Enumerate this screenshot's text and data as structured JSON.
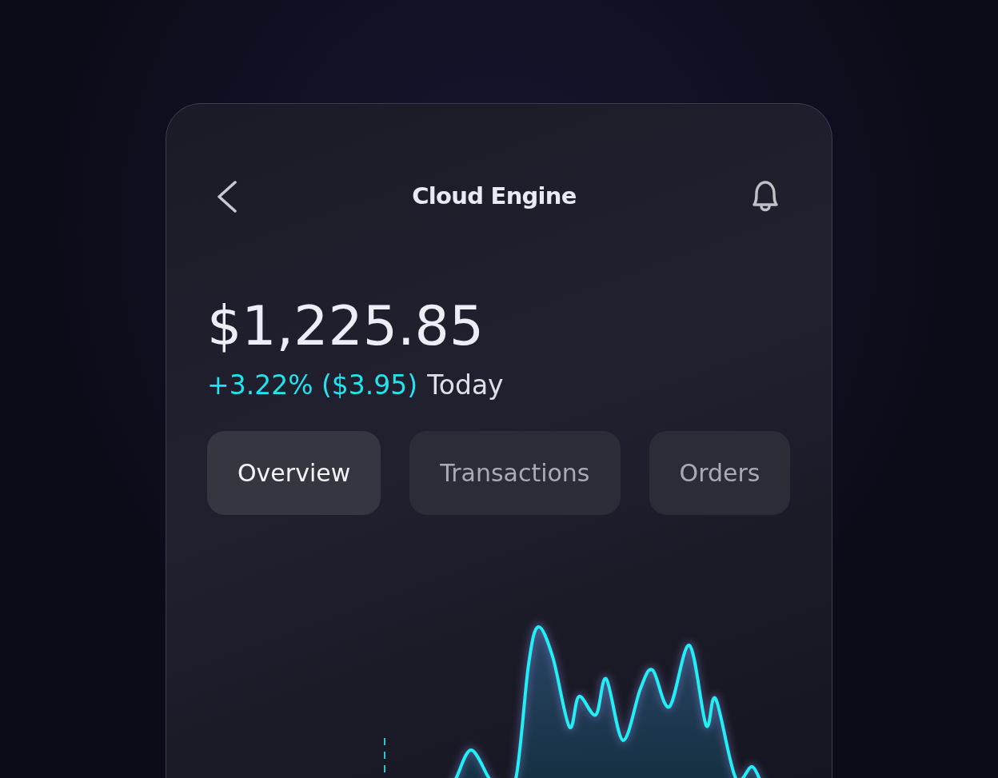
{
  "header": {
    "title": "Cloud Engine"
  },
  "balance": "$1,225.85",
  "change": {
    "delta": "+3.22% ($3.95)",
    "period": "Today"
  },
  "tabs": [
    {
      "label": "Overview",
      "selected": true
    },
    {
      "label": "Transactions",
      "selected": false
    },
    {
      "label": "Orders",
      "selected": false
    }
  ]
}
